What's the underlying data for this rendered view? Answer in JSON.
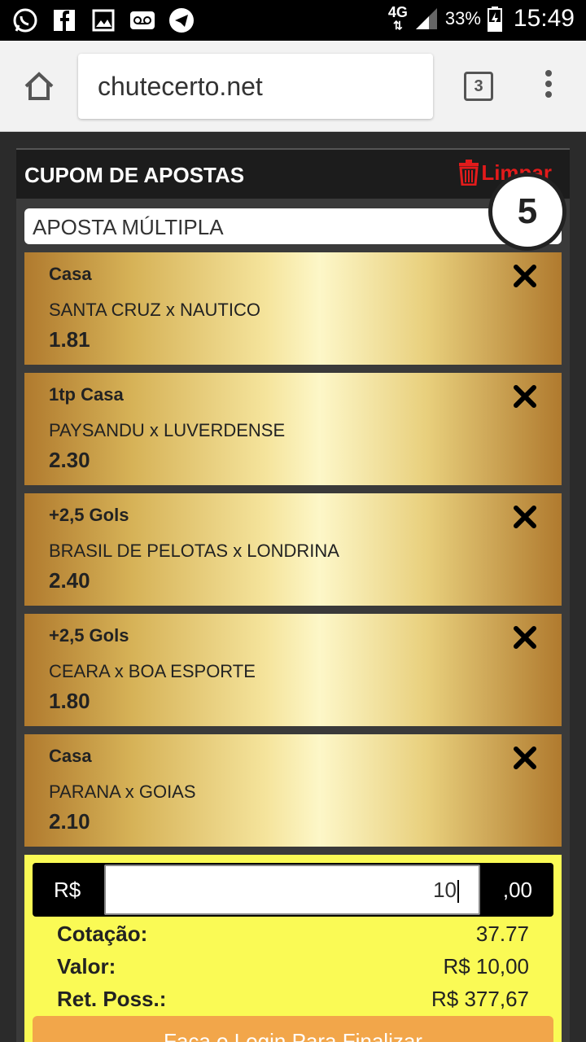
{
  "status_bar": {
    "network": "4G",
    "battery_percent": "33%",
    "time": "15:49",
    "icons": [
      "whatsapp-icon",
      "facebook-icon",
      "gallery-icon",
      "voicemail-icon",
      "telegram-icon"
    ]
  },
  "browser": {
    "url": "chutecerto.net",
    "tab_count": "3"
  },
  "coupon": {
    "title": "CUPOM DE APOSTAS",
    "clear_label": "Limpar",
    "bet_type": "APOSTA MÚLTIPLA",
    "selection_count": "5",
    "bets": [
      {
        "type": "Casa",
        "match": "SANTA CRUZ x NAUTICO",
        "odd": "1.81"
      },
      {
        "type": "1tp Casa",
        "match": "PAYSANDU x LUVERDENSE",
        "odd": "2.30"
      },
      {
        "type": "+2,5 Gols",
        "match": "BRASIL DE PELOTAS x LONDRINA",
        "odd": "2.40"
      },
      {
        "type": "+2,5 Gols",
        "match": "CEARA x BOA ESPORTE",
        "odd": "1.80"
      },
      {
        "type": "Casa",
        "match": "PARANA x GOIAS",
        "odd": "2.10"
      }
    ],
    "stake": {
      "currency": "R$",
      "value": "10",
      "cents": ",00"
    },
    "summary": {
      "cotacao_label": "Cotação:",
      "cotacao_value": "37.77",
      "valor_label": "Valor:",
      "valor_value": "R$ 10,00",
      "retorno_label": "Ret. Poss.:",
      "retorno_value": "R$ 377,67"
    },
    "login_button": "Faça o Login Para Finalizar"
  },
  "colors": {
    "accent_red": "#e21b1b",
    "summary_yellow": "#fafa55",
    "button_orange": "#f2a64a"
  }
}
